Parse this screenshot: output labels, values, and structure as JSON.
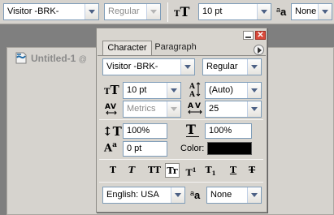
{
  "options_bar": {
    "font_family": "Visitor -BRK-",
    "font_style": "Regular",
    "font_size": "10 pt",
    "antialias_label": "a",
    "antialias_sublabel": "a",
    "antialias": "None"
  },
  "document": {
    "title": "Untitled-1",
    "title_suffix": "@"
  },
  "palette": {
    "tabs": [
      "Character",
      "Paragraph"
    ],
    "font_family": "Visitor -BRK-",
    "font_style": "Regular",
    "font_size": "10 pt",
    "leading": "(Auto)",
    "kerning": "Metrics",
    "tracking": "25",
    "vertical_scale": "100%",
    "horizontal_scale": "100%",
    "baseline_shift": "0 pt",
    "color_label": "Color:",
    "color_value": "#000000",
    "style_buttons": [
      "T",
      "T",
      "TT",
      "Tr",
      "T",
      "T",
      "T",
      "T"
    ],
    "style_superscript": "1",
    "style_subscript": "1",
    "language": "English: USA",
    "antialias": "None"
  },
  "colors": {
    "swatch": "#000000",
    "close": "#d9493a"
  }
}
